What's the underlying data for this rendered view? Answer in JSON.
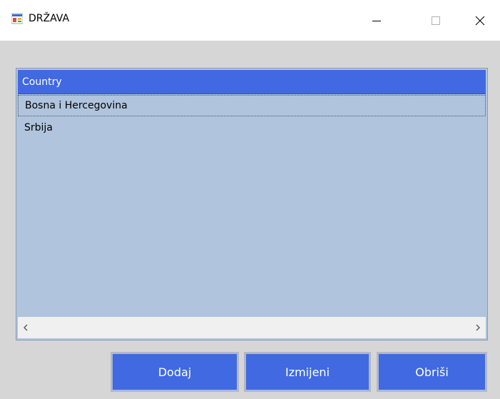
{
  "window": {
    "title": "DRŽAVA",
    "icon": "form-app-icon",
    "controls": {
      "minimize": "minimize-icon",
      "maximize": "maximize-icon",
      "close": "close-icon"
    }
  },
  "list": {
    "column_header": "Country",
    "rows": [
      "Bosna i Hercegovina",
      "Srbija"
    ],
    "focused_row": 0,
    "colors": {
      "header_bg": "#4169e1",
      "list_bg": "#b0c4de"
    }
  },
  "buttons": {
    "add_label": "Dodaj",
    "edit_label": "Izmijeni",
    "delete_label": "Obriši",
    "color": "#4169e1"
  }
}
